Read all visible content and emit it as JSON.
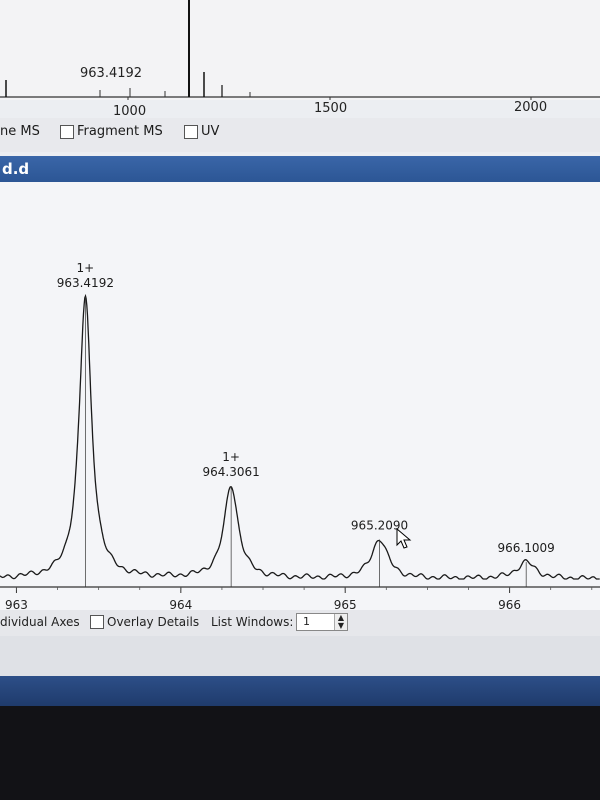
{
  "overview": {
    "peak_label": "963.4192",
    "axis_ticks": [
      "1000",
      "1500",
      "2000"
    ]
  },
  "checkbox_row": {
    "partial_label": "ne MS",
    "fragment_ms_label": "Fragment MS",
    "fragment_ms_checked": false,
    "uv_label": "UV",
    "uv_checked": false
  },
  "window": {
    "title": "d.d"
  },
  "chart_data": {
    "type": "line",
    "x_ticks": [
      "963",
      "964",
      "965",
      "966"
    ],
    "xlim": [
      962.9,
      966.55
    ],
    "peaks": [
      {
        "mz": 963.4192,
        "relative_intensity": 1.0,
        "charge": "1+",
        "label": "963.4192"
      },
      {
        "mz": 964.3061,
        "relative_intensity": 0.33,
        "charge": "1+",
        "label": "964.3061"
      },
      {
        "mz": 965.209,
        "relative_intensity": 0.14,
        "charge": "",
        "label": "965.2090"
      },
      {
        "mz": 966.1009,
        "relative_intensity": 0.06,
        "charge": "",
        "label": "966.1009"
      }
    ]
  },
  "bottom_bar": {
    "individual_axes_label": "dividual Axes",
    "overlay_details_label": "Overlay Details",
    "overlay_details_checked": false,
    "list_windows_label": "List Windows:",
    "list_windows_value": "1"
  }
}
